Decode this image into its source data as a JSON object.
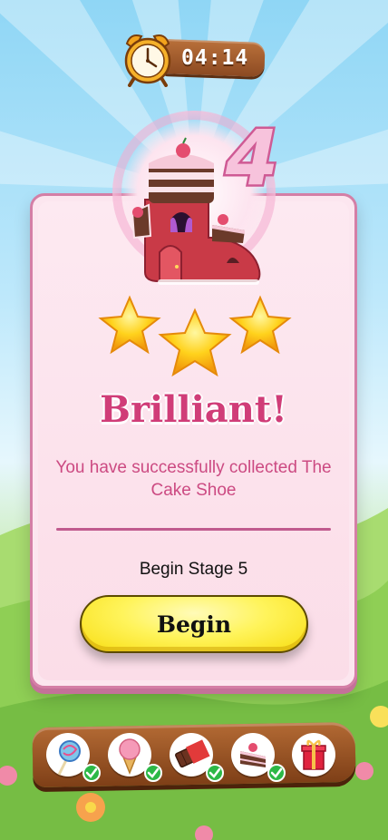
{
  "timer": {
    "value": "04:14",
    "icon": "alarm-clock-icon"
  },
  "stage": {
    "completed_number": "4",
    "next_label": "Begin Stage 5"
  },
  "reward": {
    "item_name": "The Cake Shoe",
    "icon": "cake-shoe-house-icon"
  },
  "rating": {
    "stars_earned": 3,
    "stars_total": 3
  },
  "result": {
    "title": "Brilliant!",
    "message": "You have successfully collected The Cake Shoe"
  },
  "buttons": {
    "begin_label": "Begin"
  },
  "collection": [
    {
      "icon": "lollipop-icon",
      "collected": true
    },
    {
      "icon": "ice-cream-cone-icon",
      "collected": true
    },
    {
      "icon": "chocolate-bar-icon",
      "collected": true
    },
    {
      "icon": "cake-slice-icon",
      "collected": true
    },
    {
      "icon": "gift-box-icon",
      "collected": false
    }
  ],
  "colors": {
    "accent_pink": "#d03d78",
    "button_yellow": "#fff45c",
    "check_green": "#2cb846",
    "wood": "#9a5527"
  }
}
